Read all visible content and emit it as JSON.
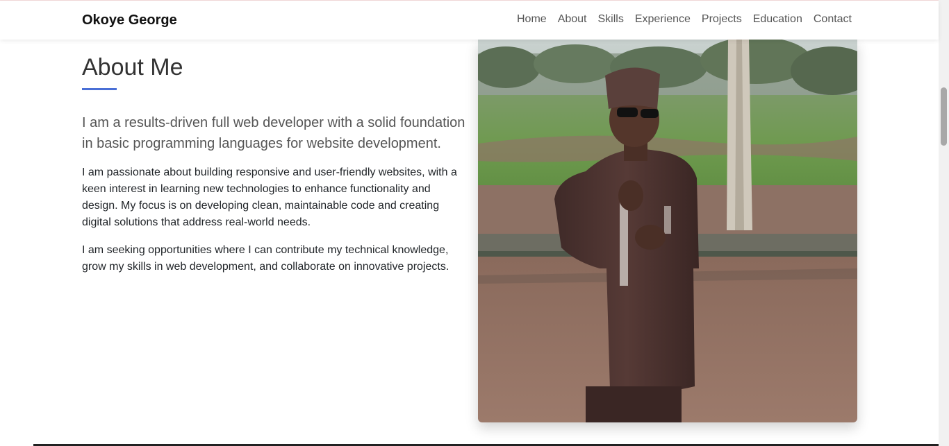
{
  "navbar": {
    "brand": "Okoye George",
    "links": [
      "Home",
      "About",
      "Skills",
      "Experience",
      "Projects",
      "Education",
      "Contact"
    ]
  },
  "about": {
    "title": "About Me",
    "lead": "I am a results-driven full web developer with a solid foundation in basic programming languages for website development.",
    "paragraphs": [
      "I am passionate about building responsive and user-friendly websites, with a keen interest in learning new technologies to enhance functionality and design. My focus is on developing clean, maintainable code and creating digital solutions that address real-world needs.",
      "I am seeking opportunities where I can contribute my technical knowledge, grow my skills in web development, and collaborate on innovative projects."
    ]
  },
  "colors": {
    "accent": "#4a6fd6",
    "heading": "#333333",
    "nav_text": "#555555"
  }
}
